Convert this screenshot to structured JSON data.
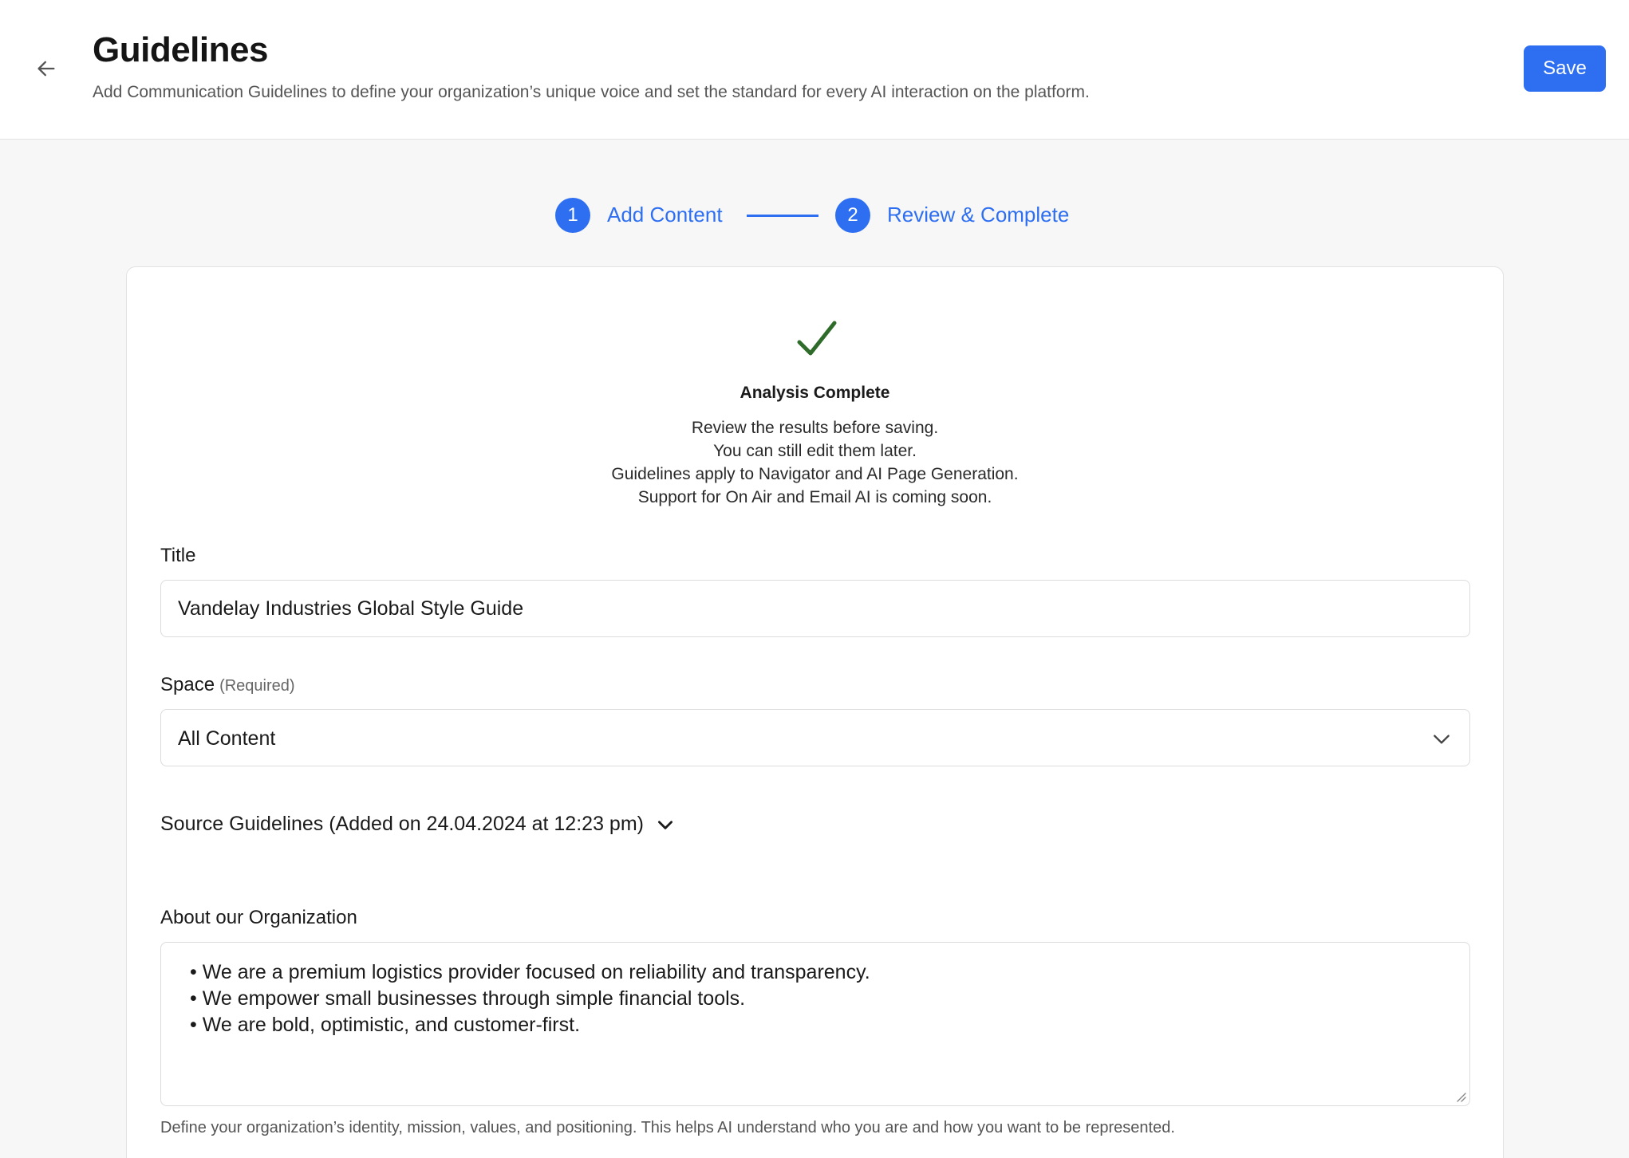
{
  "header": {
    "title": "Guidelines",
    "subtitle": "Add Communication Guidelines to define your organization’s unique voice and set the standard for every AI interaction on the platform.",
    "save_label": "Save"
  },
  "stepper": {
    "steps": [
      {
        "number": "1",
        "label": "Add Content"
      },
      {
        "number": "2",
        "label": "Review & Complete"
      }
    ]
  },
  "analysis": {
    "title": "Analysis Complete",
    "lines": [
      "Review the results before saving.",
      "You can still edit them later.",
      "Guidelines apply to Navigator and AI Page Generation.",
      "Support for On Air and Email AI is coming soon."
    ]
  },
  "form": {
    "title_label": "Title",
    "title_value": "Vandelay Industries Global Style Guide",
    "space_label": "Space",
    "space_required": "(Required)",
    "space_value": "All Content",
    "source_guidelines_label": "Source Guidelines (Added on 24.04.2024 at 12:23 pm)",
    "about_label": "About our Organization",
    "about_items": [
      "We are a premium logistics provider focused on reliability and transparency.",
      "We empower small businesses through simple financial tools.",
      "We are bold, optimistic, and customer-first."
    ],
    "about_helper": "Define your organization’s identity, mission, values, and positioning. This helps AI understand who you are and how you want to be represented."
  },
  "icons": {
    "back": "arrow-left-icon",
    "check": "checkmark-icon",
    "chevron": "chevron-down-icon",
    "resize": "resize-handle-icon"
  },
  "colors": {
    "accent": "#2e6ff2",
    "success": "#2f6b2a",
    "background": "#f7f7f7"
  }
}
